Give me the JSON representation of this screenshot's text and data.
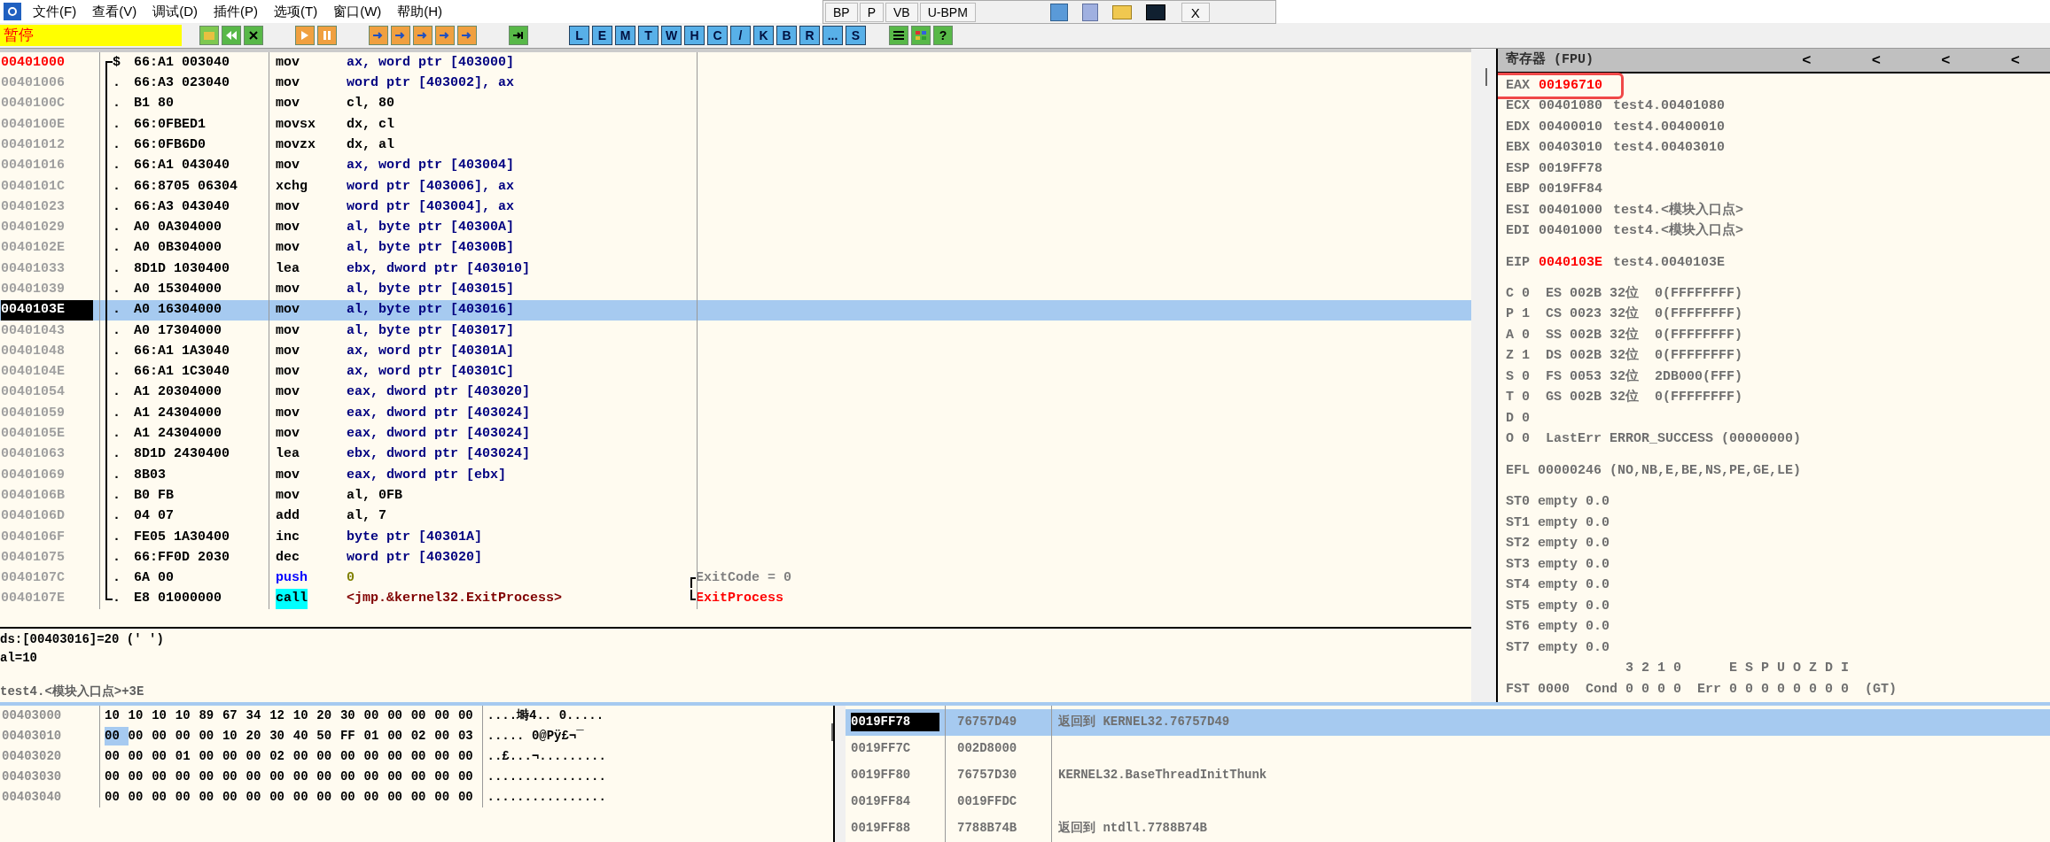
{
  "menu": [
    "文件(F)",
    "查看(V)",
    "调试(D)",
    "插件(P)",
    "选项(T)",
    "窗口(W)",
    "帮助(H)"
  ],
  "status": "暂停",
  "letter_buttons": [
    "L",
    "E",
    "M",
    "T",
    "W",
    "H",
    "C",
    "/",
    "K",
    "B",
    "R",
    "...",
    "S"
  ],
  "help_button": "?",
  "float_toolbar": {
    "buttons": [
      "BP",
      "P",
      "VB",
      "U-BPM"
    ],
    "close": "X"
  },
  "disasm": [
    {
      "address": "00401000",
      "kind": "entry",
      "marker": "$",
      "bytes": "66:A1 003040",
      "mnemonic": {
        "text": "mov",
        "kind": "plain"
      },
      "operands": {
        "text": "ax, word ptr [403000]",
        "kind": "mem"
      },
      "selected": false
    },
    {
      "address": "00401006",
      "kind": "plain",
      "marker": ".",
      "bytes": "66:A3 023040",
      "mnemonic": {
        "text": "mov",
        "kind": "plain"
      },
      "operands": {
        "text": "word ptr [403002], ax",
        "kind": "mem"
      },
      "selected": false
    },
    {
      "address": "0040100C",
      "kind": "plain",
      "marker": ".",
      "bytes": "B1 80",
      "mnemonic": {
        "text": "mov",
        "kind": "plain"
      },
      "operands": {
        "text": "cl, 80",
        "kind": "imm"
      },
      "selected": false
    },
    {
      "address": "0040100E",
      "kind": "plain",
      "marker": ".",
      "bytes": "66:0FBED1",
      "mnemonic": {
        "text": "movsx",
        "kind": "plain"
      },
      "operands": {
        "text": "dx, cl",
        "kind": "reg"
      },
      "selected": false
    },
    {
      "address": "00401012",
      "kind": "plain",
      "marker": ".",
      "bytes": "66:0FB6D0",
      "mnemonic": {
        "text": "movzx",
        "kind": "plain"
      },
      "operands": {
        "text": "dx, al",
        "kind": "reg"
      },
      "selected": false
    },
    {
      "address": "00401016",
      "kind": "plain",
      "marker": ".",
      "bytes": "66:A1 043040",
      "mnemonic": {
        "text": "mov",
        "kind": "plain"
      },
      "operands": {
        "text": "ax, word ptr [403004]",
        "kind": "mem"
      },
      "selected": false
    },
    {
      "address": "0040101C",
      "kind": "plain",
      "marker": ".",
      "bytes": "66:8705 06304",
      "mnemonic": {
        "text": "xchg",
        "kind": "plain"
      },
      "operands": {
        "text": "word ptr [403006], ax",
        "kind": "mem"
      },
      "selected": false
    },
    {
      "address": "00401023",
      "kind": "plain",
      "marker": ".",
      "bytes": "66:A3 043040",
      "mnemonic": {
        "text": "mov",
        "kind": "plain"
      },
      "operands": {
        "text": "word ptr [403004], ax",
        "kind": "mem"
      },
      "selected": false
    },
    {
      "address": "00401029",
      "kind": "plain",
      "marker": ".",
      "bytes": "A0 0A304000",
      "mnemonic": {
        "text": "mov",
        "kind": "plain"
      },
      "operands": {
        "text": "al, byte ptr [40300A]",
        "kind": "mem"
      },
      "selected": false
    },
    {
      "address": "0040102E",
      "kind": "plain",
      "marker": ".",
      "bytes": "A0 0B304000",
      "mnemonic": {
        "text": "mov",
        "kind": "plain"
      },
      "operands": {
        "text": "al, byte ptr [40300B]",
        "kind": "mem"
      },
      "selected": false
    },
    {
      "address": "00401033",
      "kind": "plain",
      "marker": ".",
      "bytes": "8D1D 1030400",
      "mnemonic": {
        "text": "lea",
        "kind": "plain"
      },
      "operands": {
        "text": "ebx, dword ptr [403010]",
        "kind": "mem"
      },
      "selected": false
    },
    {
      "address": "00401039",
      "kind": "plain",
      "marker": ".",
      "bytes": "A0 15304000",
      "mnemonic": {
        "text": "mov",
        "kind": "plain"
      },
      "operands": {
        "text": "al, byte ptr [403015]",
        "kind": "mem"
      },
      "selected": false
    },
    {
      "address": "0040103E",
      "kind": "eip",
      "marker": ".",
      "bytes": "A0 16304000",
      "mnemonic": {
        "text": "mov",
        "kind": "plain"
      },
      "operands": {
        "text": "al, byte ptr [403016]",
        "kind": "mem"
      },
      "selected": true
    },
    {
      "address": "00401043",
      "kind": "plain",
      "marker": ".",
      "bytes": "A0 17304000",
      "mnemonic": {
        "text": "mov",
        "kind": "plain"
      },
      "operands": {
        "text": "al, byte ptr [403017]",
        "kind": "mem"
      },
      "selected": false
    },
    {
      "address": "00401048",
      "kind": "plain",
      "marker": ".",
      "bytes": "66:A1 1A3040",
      "mnemonic": {
        "text": "mov",
        "kind": "plain"
      },
      "operands": {
        "text": "ax, word ptr [40301A]",
        "kind": "mem"
      },
      "selected": false
    },
    {
      "address": "0040104E",
      "kind": "plain",
      "marker": ".",
      "bytes": "66:A1 1C3040",
      "mnemonic": {
        "text": "mov",
        "kind": "plain"
      },
      "operands": {
        "text": "ax, word ptr [40301C]",
        "kind": "mem"
      },
      "selected": false
    },
    {
      "address": "00401054",
      "kind": "plain",
      "marker": ".",
      "bytes": "A1 20304000",
      "mnemonic": {
        "text": "mov",
        "kind": "plain"
      },
      "operands": {
        "text": "eax, dword ptr [403020]",
        "kind": "mem"
      },
      "selected": false
    },
    {
      "address": "00401059",
      "kind": "plain",
      "marker": ".",
      "bytes": "A1 24304000",
      "mnemonic": {
        "text": "mov",
        "kind": "plain"
      },
      "operands": {
        "text": "eax, dword ptr [403024]",
        "kind": "mem"
      },
      "selected": false
    },
    {
      "address": "0040105E",
      "kind": "plain",
      "marker": ".",
      "bytes": "A1 24304000",
      "mnemonic": {
        "text": "mov",
        "kind": "plain"
      },
      "operands": {
        "text": "eax, dword ptr [403024]",
        "kind": "mem"
      },
      "selected": false
    },
    {
      "address": "00401063",
      "kind": "plain",
      "marker": ".",
      "bytes": "8D1D 2430400",
      "mnemonic": {
        "text": "lea",
        "kind": "plain"
      },
      "operands": {
        "text": "ebx, dword ptr [403024]",
        "kind": "mem"
      },
      "selected": false
    },
    {
      "address": "00401069",
      "kind": "plain",
      "marker": ".",
      "bytes": "8B03",
      "mnemonic": {
        "text": "mov",
        "kind": "plain"
      },
      "operands": {
        "text": "eax, dword ptr [ebx]",
        "kind": "mem"
      },
      "selected": false
    },
    {
      "address": "0040106B",
      "kind": "plain",
      "marker": ".",
      "bytes": "B0 FB",
      "mnemonic": {
        "text": "mov",
        "kind": "plain"
      },
      "operands": {
        "text": "al, 0FB",
        "kind": "imm"
      },
      "selected": false
    },
    {
      "address": "0040106D",
      "kind": "plain",
      "marker": ".",
      "bytes": "04 07",
      "mnemonic": {
        "text": "add",
        "kind": "plain"
      },
      "operands": {
        "text": "al, 7",
        "kind": "imm"
      },
      "selected": false
    },
    {
      "address": "0040106F",
      "kind": "plain",
      "marker": ".",
      "bytes": "FE05 1A30400",
      "mnemonic": {
        "text": "inc",
        "kind": "plain"
      },
      "operands": {
        "text": "byte ptr [40301A]",
        "kind": "mem"
      },
      "selected": false
    },
    {
      "address": "00401075",
      "kind": "plain",
      "marker": ".",
      "bytes": "66:FF0D 2030",
      "mnemonic": {
        "text": "dec",
        "kind": "plain"
      },
      "operands": {
        "text": "word ptr [403020]",
        "kind": "mem"
      },
      "selected": false
    },
    {
      "address": "0040107C",
      "kind": "plain",
      "marker": ".",
      "bytes": "6A 00",
      "mnemonic": {
        "text": "push",
        "kind": "push"
      },
      "operands": {
        "text": "0",
        "kind": "immonly"
      },
      "comment": {
        "text": "ExitCode = 0",
        "kind": "arg"
      },
      "selected": false
    },
    {
      "address": "0040107E",
      "kind": "plain",
      "marker": ".",
      "bytes": "E8 01000000",
      "mnemonic": {
        "text": "call",
        "kind": "call"
      },
      "operands": {
        "text": "<jmp.&kernel32.ExitProcess>",
        "kind": "target"
      },
      "comment": {
        "text": "ExitProcess",
        "kind": "api"
      },
      "selected": false
    }
  ],
  "info": [
    "ds:[00403016]=20 (' ')",
    "al=10",
    "test4.<模块入口点>+3E"
  ],
  "registers": {
    "title": "寄存器 (FPU)",
    "arrows": [
      "<",
      "<",
      "<",
      "<"
    ],
    "general": [
      {
        "name": "EAX",
        "value": "00196710",
        "changed": true,
        "boxed": true
      },
      {
        "name": "ECX",
        "value": "00401080",
        "comment": "test4.00401080",
        "changed": false,
        "boxed": false
      },
      {
        "name": "EDX",
        "value": "00400010",
        "comment": "test4.00400010",
        "changed": false,
        "boxed": false
      },
      {
        "name": "EBX",
        "value": "00403010",
        "comment": "test4.00403010",
        "changed": false,
        "boxed": false
      },
      {
        "name": "ESP",
        "value": "0019FF78",
        "changed": false,
        "boxed": false
      },
      {
        "name": "EBP",
        "value": "0019FF84",
        "changed": false,
        "boxed": false
      },
      {
        "name": "ESI",
        "value": "00401000",
        "comment": "test4.<模块入口点>",
        "changed": false,
        "boxed": false
      },
      {
        "name": "EDI",
        "value": "00401000",
        "comment": "test4.<模块入口点>",
        "changed": false,
        "boxed": false
      }
    ],
    "eip": {
      "name": "EIP",
      "value": "0040103E",
      "comment": "test4.0040103E",
      "changed": true
    },
    "flags": [
      "C 0  ES 002B 32位  0(FFFFFFFF)",
      "P 1  CS 0023 32位  0(FFFFFFFF)",
      "A 0  SS 002B 32位  0(FFFFFFFF)",
      "Z 1  DS 002B 32位  0(FFFFFFFF)",
      "S 0  FS 0053 32位  2DB000(FFF)",
      "T 0  GS 002B 32位  0(FFFFFFFF)",
      "D 0",
      "O 0  LastErr ERROR_SUCCESS (00000000)"
    ],
    "efl": "EFL 00000246 (NO,NB,E,BE,NS,PE,GE,LE)",
    "fpu": [
      "ST0 empty 0.0",
      "ST1 empty 0.0",
      "ST2 empty 0.0",
      "ST3 empty 0.0",
      "ST4 empty 0.0",
      "ST5 empty 0.0",
      "ST6 empty 0.0",
      "ST7 empty 0.0"
    ],
    "fst_header": "               3 2 1 0      E S P U O Z D I",
    "fst": "FST 0000  Cond 0 0 0 0  Err 0 0 0 0 0 0 0 0  (GT)"
  },
  "dump": [
    {
      "address": "00403000",
      "hex": [
        {
          "text": "10",
          "selected": false
        },
        {
          "text": "10",
          "selected": false
        },
        {
          "text": "10",
          "selected": false
        },
        {
          "text": "10",
          "selected": false
        },
        {
          "text": "89",
          "selected": false
        },
        {
          "text": "67",
          "selected": false
        },
        {
          "text": "34",
          "selected": false
        },
        {
          "text": "12",
          "selected": false
        },
        {
          "text": "10",
          "selected": false
        },
        {
          "text": "20",
          "selected": false
        },
        {
          "text": "30",
          "selected": false
        },
        {
          "text": "00",
          "selected": false
        },
        {
          "text": "00",
          "selected": false
        },
        {
          "text": "00",
          "selected": false
        },
        {
          "text": "00",
          "selected": false
        },
        {
          "text": "00",
          "selected": false
        }
      ],
      "ascii": "....塒4.. 0....."
    },
    {
      "address": "00403010",
      "hex": [
        {
          "text": "00",
          "selected": true
        },
        {
          "text": "00",
          "selected": false
        },
        {
          "text": "00",
          "selected": false
        },
        {
          "text": "00",
          "selected": false
        },
        {
          "text": "00",
          "selected": false
        },
        {
          "text": "10",
          "selected": false
        },
        {
          "text": "20",
          "selected": false
        },
        {
          "text": "30",
          "selected": false
        },
        {
          "text": "40",
          "selected": false
        },
        {
          "text": "50",
          "selected": false
        },
        {
          "text": "FF",
          "selected": false
        },
        {
          "text": "01",
          "selected": false
        },
        {
          "text": "00",
          "selected": false
        },
        {
          "text": "02",
          "selected": false
        },
        {
          "text": "00",
          "selected": false
        },
        {
          "text": "03",
          "selected": false
        }
      ],
      "ascii": "..... 0@Pÿ£¬¯"
    },
    {
      "address": "00403020",
      "hex": [
        {
          "text": "00",
          "selected": false
        },
        {
          "text": "00",
          "selected": false
        },
        {
          "text": "00",
          "selected": false
        },
        {
          "text": "01",
          "selected": false
        },
        {
          "text": "00",
          "selected": false
        },
        {
          "text": "00",
          "selected": false
        },
        {
          "text": "00",
          "selected": false
        },
        {
          "text": "02",
          "selected": false
        },
        {
          "text": "00",
          "selected": false
        },
        {
          "text": "00",
          "selected": false
        },
        {
          "text": "00",
          "selected": false
        },
        {
          "text": "00",
          "selected": false
        },
        {
          "text": "00",
          "selected": false
        },
        {
          "text": "00",
          "selected": false
        },
        {
          "text": "00",
          "selected": false
        },
        {
          "text": "00",
          "selected": false
        }
      ],
      "ascii": "..£...¬........."
    },
    {
      "address": "00403030",
      "hex": [
        {
          "text": "00",
          "selected": false
        },
        {
          "text": "00",
          "selected": false
        },
        {
          "text": "00",
          "selected": false
        },
        {
          "text": "00",
          "selected": false
        },
        {
          "text": "00",
          "selected": false
        },
        {
          "text": "00",
          "selected": false
        },
        {
          "text": "00",
          "selected": false
        },
        {
          "text": "00",
          "selected": false
        },
        {
          "text": "00",
          "selected": false
        },
        {
          "text": "00",
          "selected": false
        },
        {
          "text": "00",
          "selected": false
        },
        {
          "text": "00",
          "selected": false
        },
        {
          "text": "00",
          "selected": false
        },
        {
          "text": "00",
          "selected": false
        },
        {
          "text": "00",
          "selected": false
        },
        {
          "text": "00",
          "selected": false
        }
      ],
      "ascii": "................"
    },
    {
      "address": "00403040",
      "hex": [
        {
          "text": "00",
          "selected": false
        },
        {
          "text": "00",
          "selected": false
        },
        {
          "text": "00",
          "selected": false
        },
        {
          "text": "00",
          "selected": false
        },
        {
          "text": "00",
          "selected": false
        },
        {
          "text": "00",
          "selected": false
        },
        {
          "text": "00",
          "selected": false
        },
        {
          "text": "00",
          "selected": false
        },
        {
          "text": "00",
          "selected": false
        },
        {
          "text": "00",
          "selected": false
        },
        {
          "text": "00",
          "selected": false
        },
        {
          "text": "00",
          "selected": false
        },
        {
          "text": "00",
          "selected": false
        },
        {
          "text": "00",
          "selected": false
        },
        {
          "text": "00",
          "selected": false
        },
        {
          "text": "00",
          "selected": false
        }
      ],
      "ascii": "................"
    }
  ],
  "stack": [
    {
      "address": "0019FF78",
      "value": "76757D49",
      "comment": "返回到 KERNEL32.76757D49",
      "selected": true
    },
    {
      "address": "0019FF7C",
      "value": "002D8000",
      "selected": false
    },
    {
      "address": "0019FF80",
      "value": "76757D30",
      "comment": "KERNEL32.BaseThreadInitThunk",
      "selected": false
    },
    {
      "address": "0019FF84",
      "value": "0019FFDC",
      "selected": false
    },
    {
      "address": "0019FF88",
      "value": "7788B74B",
      "comment": "返回到 ntdll.7788B74B",
      "selected": false
    }
  ]
}
